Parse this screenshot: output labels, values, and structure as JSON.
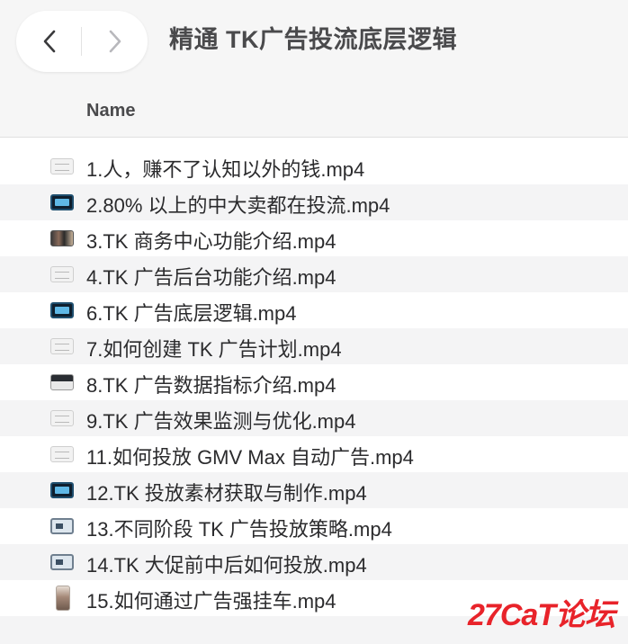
{
  "window": {
    "title": "精通 TK广告投流底层逻辑",
    "back_icon": "chevron-left-icon",
    "forward_icon": "chevron-right-icon"
  },
  "columns": {
    "name_label": "Name"
  },
  "files": [
    {
      "name": "1.人，赚不了认知以外的钱.mp4",
      "thumb": "doc"
    },
    {
      "name": "2.80% 以上的中大卖都在投流.mp4",
      "thumb": "screen"
    },
    {
      "name": "3.TK 商务中心功能介绍.mp4",
      "thumb": "photo"
    },
    {
      "name": "4.TK 广告后台功能介绍.mp4",
      "thumb": "doc"
    },
    {
      "name": "6.TK 广告底层逻辑.mp4",
      "thumb": "screen"
    },
    {
      "name": "7.如何创建 TK 广告计划.mp4",
      "thumb": "doc"
    },
    {
      "name": "8.TK 广告数据指标介绍.mp4",
      "thumb": "dark"
    },
    {
      "name": "9.TK 广告效果监测与优化.mp4",
      "thumb": "doc"
    },
    {
      "name": "11.如何投放 GMV Max 自动广告.mp4",
      "thumb": "doc"
    },
    {
      "name": "12.TK 投放素材获取与制作.mp4",
      "thumb": "screen"
    },
    {
      "name": "13.不同阶段 TK 广告投放策略.mp4",
      "thumb": "small"
    },
    {
      "name": "14.TK 大促前中后如何投放.mp4",
      "thumb": "small"
    },
    {
      "name": "15.如何通过广告强挂车.mp4",
      "thumb": "person"
    }
  ],
  "watermark": "27CaT论坛",
  "colors": {
    "toolbar_bg": "#f6f6f6",
    "alt_row_bg": "#f4f4f5",
    "watermark_red": "#e8232a"
  }
}
